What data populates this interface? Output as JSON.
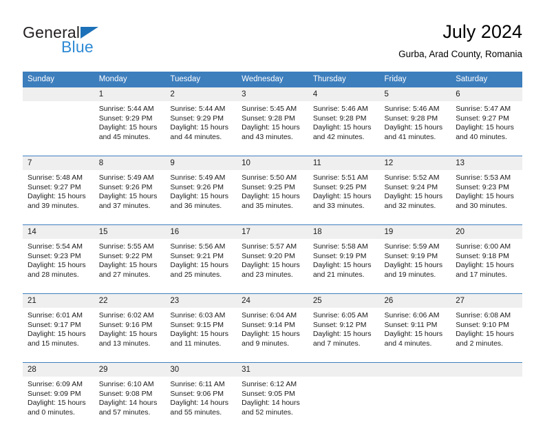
{
  "brand": {
    "name_part1": "General",
    "name_part2": "Blue",
    "accent_color": "#2e8ad4",
    "triangle_color": "#1d71b8"
  },
  "header": {
    "title": "July 2024",
    "subtitle": "Gurba, Arad County, Romania",
    "header_bg": "#3d7ebd"
  },
  "calendar": {
    "weekday_headers": [
      "Sunday",
      "Monday",
      "Tuesday",
      "Wednesday",
      "Thursday",
      "Friday",
      "Saturday"
    ],
    "weeks": [
      [
        {
          "day": "",
          "sunrise": "",
          "sunset": "",
          "daylight1": "",
          "daylight2": ""
        },
        {
          "day": "1",
          "sunrise": "Sunrise: 5:44 AM",
          "sunset": "Sunset: 9:29 PM",
          "daylight1": "Daylight: 15 hours",
          "daylight2": "and 45 minutes."
        },
        {
          "day": "2",
          "sunrise": "Sunrise: 5:44 AM",
          "sunset": "Sunset: 9:29 PM",
          "daylight1": "Daylight: 15 hours",
          "daylight2": "and 44 minutes."
        },
        {
          "day": "3",
          "sunrise": "Sunrise: 5:45 AM",
          "sunset": "Sunset: 9:28 PM",
          "daylight1": "Daylight: 15 hours",
          "daylight2": "and 43 minutes."
        },
        {
          "day": "4",
          "sunrise": "Sunrise: 5:46 AM",
          "sunset": "Sunset: 9:28 PM",
          "daylight1": "Daylight: 15 hours",
          "daylight2": "and 42 minutes."
        },
        {
          "day": "5",
          "sunrise": "Sunrise: 5:46 AM",
          "sunset": "Sunset: 9:28 PM",
          "daylight1": "Daylight: 15 hours",
          "daylight2": "and 41 minutes."
        },
        {
          "day": "6",
          "sunrise": "Sunrise: 5:47 AM",
          "sunset": "Sunset: 9:27 PM",
          "daylight1": "Daylight: 15 hours",
          "daylight2": "and 40 minutes."
        }
      ],
      [
        {
          "day": "7",
          "sunrise": "Sunrise: 5:48 AM",
          "sunset": "Sunset: 9:27 PM",
          "daylight1": "Daylight: 15 hours",
          "daylight2": "and 39 minutes."
        },
        {
          "day": "8",
          "sunrise": "Sunrise: 5:49 AM",
          "sunset": "Sunset: 9:26 PM",
          "daylight1": "Daylight: 15 hours",
          "daylight2": "and 37 minutes."
        },
        {
          "day": "9",
          "sunrise": "Sunrise: 5:49 AM",
          "sunset": "Sunset: 9:26 PM",
          "daylight1": "Daylight: 15 hours",
          "daylight2": "and 36 minutes."
        },
        {
          "day": "10",
          "sunrise": "Sunrise: 5:50 AM",
          "sunset": "Sunset: 9:25 PM",
          "daylight1": "Daylight: 15 hours",
          "daylight2": "and 35 minutes."
        },
        {
          "day": "11",
          "sunrise": "Sunrise: 5:51 AM",
          "sunset": "Sunset: 9:25 PM",
          "daylight1": "Daylight: 15 hours",
          "daylight2": "and 33 minutes."
        },
        {
          "day": "12",
          "sunrise": "Sunrise: 5:52 AM",
          "sunset": "Sunset: 9:24 PM",
          "daylight1": "Daylight: 15 hours",
          "daylight2": "and 32 minutes."
        },
        {
          "day": "13",
          "sunrise": "Sunrise: 5:53 AM",
          "sunset": "Sunset: 9:23 PM",
          "daylight1": "Daylight: 15 hours",
          "daylight2": "and 30 minutes."
        }
      ],
      [
        {
          "day": "14",
          "sunrise": "Sunrise: 5:54 AM",
          "sunset": "Sunset: 9:23 PM",
          "daylight1": "Daylight: 15 hours",
          "daylight2": "and 28 minutes."
        },
        {
          "day": "15",
          "sunrise": "Sunrise: 5:55 AM",
          "sunset": "Sunset: 9:22 PM",
          "daylight1": "Daylight: 15 hours",
          "daylight2": "and 27 minutes."
        },
        {
          "day": "16",
          "sunrise": "Sunrise: 5:56 AM",
          "sunset": "Sunset: 9:21 PM",
          "daylight1": "Daylight: 15 hours",
          "daylight2": "and 25 minutes."
        },
        {
          "day": "17",
          "sunrise": "Sunrise: 5:57 AM",
          "sunset": "Sunset: 9:20 PM",
          "daylight1": "Daylight: 15 hours",
          "daylight2": "and 23 minutes."
        },
        {
          "day": "18",
          "sunrise": "Sunrise: 5:58 AM",
          "sunset": "Sunset: 9:19 PM",
          "daylight1": "Daylight: 15 hours",
          "daylight2": "and 21 minutes."
        },
        {
          "day": "19",
          "sunrise": "Sunrise: 5:59 AM",
          "sunset": "Sunset: 9:19 PM",
          "daylight1": "Daylight: 15 hours",
          "daylight2": "and 19 minutes."
        },
        {
          "day": "20",
          "sunrise": "Sunrise: 6:00 AM",
          "sunset": "Sunset: 9:18 PM",
          "daylight1": "Daylight: 15 hours",
          "daylight2": "and 17 minutes."
        }
      ],
      [
        {
          "day": "21",
          "sunrise": "Sunrise: 6:01 AM",
          "sunset": "Sunset: 9:17 PM",
          "daylight1": "Daylight: 15 hours",
          "daylight2": "and 15 minutes."
        },
        {
          "day": "22",
          "sunrise": "Sunrise: 6:02 AM",
          "sunset": "Sunset: 9:16 PM",
          "daylight1": "Daylight: 15 hours",
          "daylight2": "and 13 minutes."
        },
        {
          "day": "23",
          "sunrise": "Sunrise: 6:03 AM",
          "sunset": "Sunset: 9:15 PM",
          "daylight1": "Daylight: 15 hours",
          "daylight2": "and 11 minutes."
        },
        {
          "day": "24",
          "sunrise": "Sunrise: 6:04 AM",
          "sunset": "Sunset: 9:14 PM",
          "daylight1": "Daylight: 15 hours",
          "daylight2": "and 9 minutes."
        },
        {
          "day": "25",
          "sunrise": "Sunrise: 6:05 AM",
          "sunset": "Sunset: 9:12 PM",
          "daylight1": "Daylight: 15 hours",
          "daylight2": "and 7 minutes."
        },
        {
          "day": "26",
          "sunrise": "Sunrise: 6:06 AM",
          "sunset": "Sunset: 9:11 PM",
          "daylight1": "Daylight: 15 hours",
          "daylight2": "and 4 minutes."
        },
        {
          "day": "27",
          "sunrise": "Sunrise: 6:08 AM",
          "sunset": "Sunset: 9:10 PM",
          "daylight1": "Daylight: 15 hours",
          "daylight2": "and 2 minutes."
        }
      ],
      [
        {
          "day": "28",
          "sunrise": "Sunrise: 6:09 AM",
          "sunset": "Sunset: 9:09 PM",
          "daylight1": "Daylight: 15 hours",
          "daylight2": "and 0 minutes."
        },
        {
          "day": "29",
          "sunrise": "Sunrise: 6:10 AM",
          "sunset": "Sunset: 9:08 PM",
          "daylight1": "Daylight: 14 hours",
          "daylight2": "and 57 minutes."
        },
        {
          "day": "30",
          "sunrise": "Sunrise: 6:11 AM",
          "sunset": "Sunset: 9:06 PM",
          "daylight1": "Daylight: 14 hours",
          "daylight2": "and 55 minutes."
        },
        {
          "day": "31",
          "sunrise": "Sunrise: 6:12 AM",
          "sunset": "Sunset: 9:05 PM",
          "daylight1": "Daylight: 14 hours",
          "daylight2": "and 52 minutes."
        },
        {
          "day": "",
          "sunrise": "",
          "sunset": "",
          "daylight1": "",
          "daylight2": ""
        },
        {
          "day": "",
          "sunrise": "",
          "sunset": "",
          "daylight1": "",
          "daylight2": ""
        },
        {
          "day": "",
          "sunrise": "",
          "sunset": "",
          "daylight1": "",
          "daylight2": ""
        }
      ]
    ]
  }
}
